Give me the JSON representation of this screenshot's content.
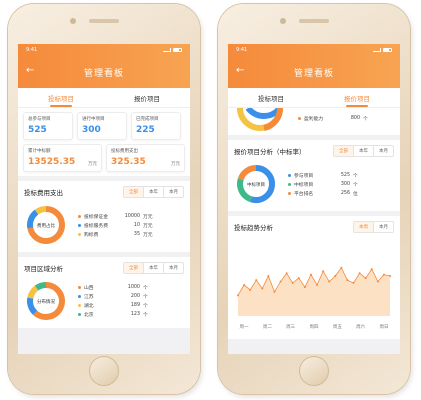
{
  "left": {
    "status_time": "9:41",
    "nav_title": "管理看板",
    "tabs": [
      "投标项目",
      "报价项目"
    ],
    "stats": [
      {
        "label": "总参与项目",
        "value": "525"
      },
      {
        "label": "进行中项目",
        "value": "300"
      },
      {
        "label": "已完成项目",
        "value": "225"
      },
      {
        "label": "累计中标额",
        "value": "13525.35",
        "unit": "万元"
      },
      {
        "label": "投标费用支出",
        "value": "325.35",
        "unit": "万元"
      }
    ],
    "cost_panel": {
      "title": "投标费用支出",
      "seg": [
        "全部",
        "本年",
        "本月"
      ],
      "center_label": "费用占比",
      "legend": [
        {
          "name": "投标保证金",
          "value": "10000",
          "unit": "万元",
          "color": "#f58a3b"
        },
        {
          "name": "投标服务费",
          "value": "10",
          "unit": "万元",
          "color": "#3a8fe8"
        },
        {
          "name": "购标费",
          "value": "35",
          "unit": "万元",
          "color": "#f5c342"
        }
      ],
      "shares": [
        0.72,
        0.18,
        0.1
      ]
    },
    "region_panel": {
      "title": "项目区域分析",
      "seg": [
        "全部",
        "本年",
        "本月"
      ],
      "center_label": "分布情况",
      "legend": [
        {
          "name": "山西",
          "value": "1000",
          "unit": "个",
          "color": "#f58a3b"
        },
        {
          "name": "江苏",
          "value": "200",
          "unit": "个",
          "color": "#3a8fe8"
        },
        {
          "name": "湖北",
          "value": "189",
          "unit": "个",
          "color": "#f5c342"
        },
        {
          "name": "北京",
          "value": "123",
          "unit": "个",
          "color": "#3fb98a"
        }
      ],
      "shares": [
        0.62,
        0.16,
        0.12,
        0.1
      ]
    }
  },
  "right": {
    "status_time": "9:41",
    "nav_title": "管理看板",
    "tabs": [
      "投标项目",
      "报价项目"
    ],
    "top_partial": {
      "name": "盈利能力",
      "value": "800",
      "unit": "个",
      "color": "#f58a3b"
    },
    "quote_panel": {
      "title": "报价项目分析（中标率）",
      "seg": [
        "全部",
        "本年",
        "本月"
      ],
      "center_label": "中标项目",
      "legend": [
        {
          "name": "参与项目",
          "value": "525",
          "unit": "个",
          "color": "#3a8fe8"
        },
        {
          "name": "中标项目",
          "value": "300",
          "unit": "个",
          "color": "#3fb98a"
        },
        {
          "name": "平台排名",
          "value": "256",
          "unit": "位",
          "color": "#f58a3b"
        }
      ],
      "shares": [
        0.55,
        0.25,
        0.2
      ]
    },
    "trend_panel": {
      "title": "投标趋势分析",
      "seg": [
        "本周",
        "本月"
      ]
    }
  },
  "chart_data": {
    "type": "area",
    "x": [
      "周一",
      "周二",
      "周三",
      "周四",
      "周五",
      "周六",
      "周日"
    ],
    "series": [
      {
        "values": [
          30,
          45,
          38,
          52,
          40,
          58,
          35,
          50,
          62,
          48,
          55,
          42,
          60,
          45,
          65,
          50,
          58,
          70,
          52,
          48,
          62,
          55,
          68,
          50,
          60,
          58
        ]
      }
    ],
    "colors": {
      "line": "#f58a3b",
      "fill": "#fbd9b5"
    }
  }
}
